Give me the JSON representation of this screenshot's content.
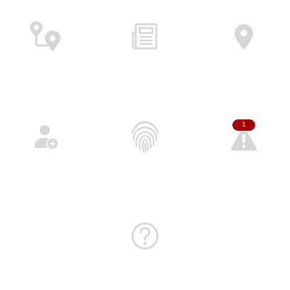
{
  "menu": {
    "items": [
      {
        "id": "routes",
        "icon": "route-pins-icon"
      },
      {
        "id": "news",
        "icon": "newspaper-icon"
      },
      {
        "id": "location",
        "icon": "location-pin-icon"
      },
      {
        "id": "add-user",
        "icon": "person-add-icon"
      },
      {
        "id": "fingerprint",
        "icon": "fingerprint-icon"
      },
      {
        "id": "alerts",
        "icon": "warning-icon",
        "badge": "1"
      },
      {
        "id": "help",
        "icon": "help-circle-icon"
      }
    ]
  },
  "colors": {
    "icon": "#d7d7d7",
    "badge_bg": "#a60000",
    "badge_text": "#ffffff"
  }
}
